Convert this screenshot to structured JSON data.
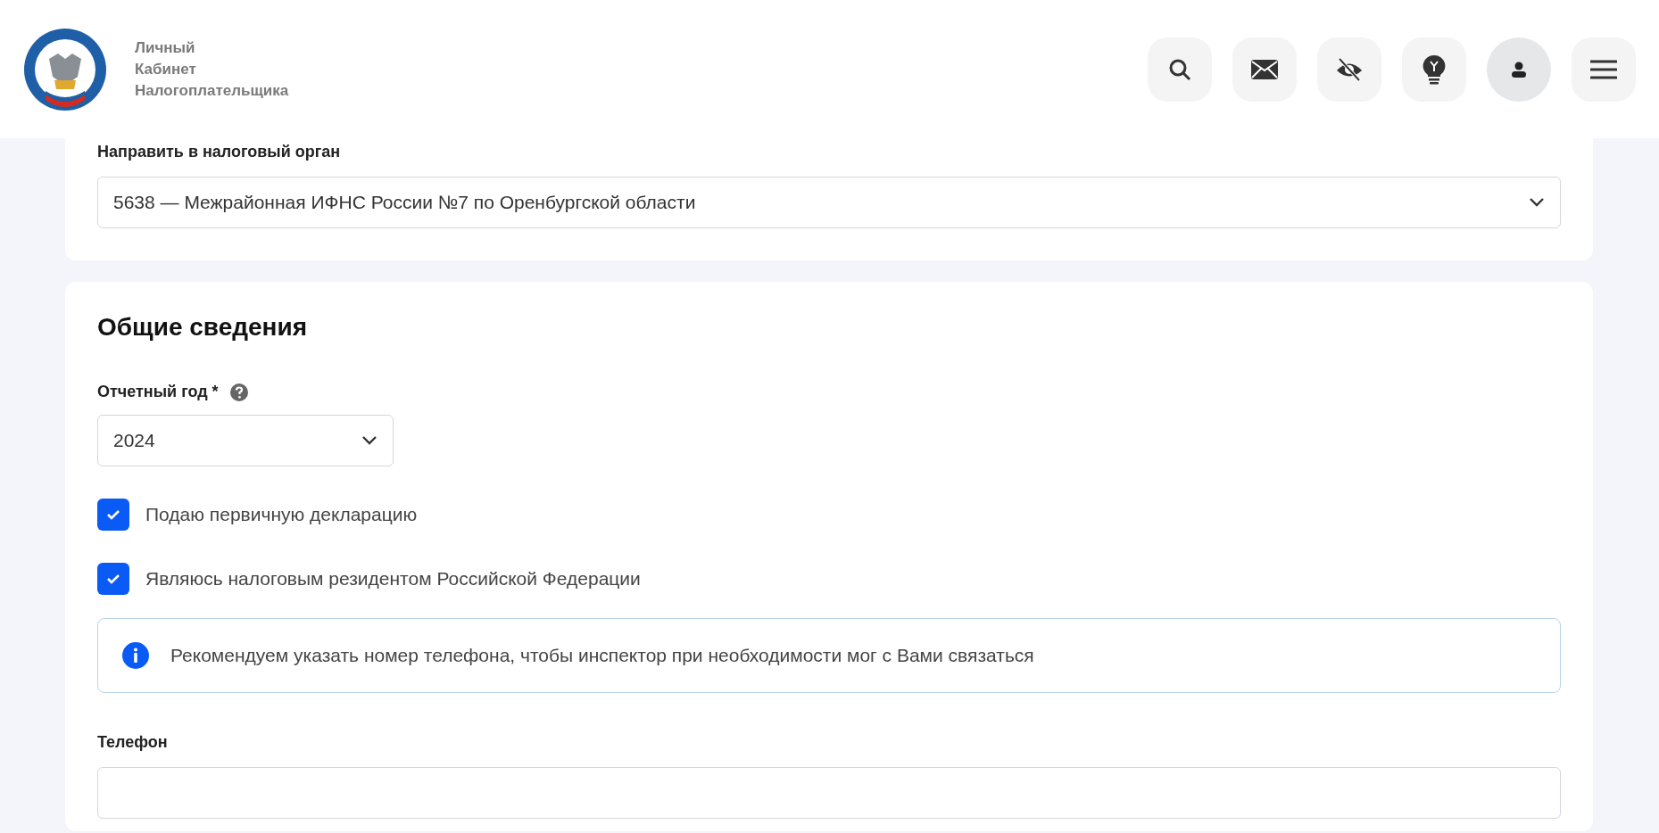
{
  "header": {
    "brand": [
      "Личный",
      "Кабинет",
      "Налогоплательщика"
    ],
    "icons": [
      {
        "kind": "search",
        "active": false
      },
      {
        "kind": "mail",
        "active": false
      },
      {
        "kind": "eye-off",
        "active": false
      },
      {
        "kind": "bulb",
        "active": false
      },
      {
        "kind": "user",
        "active": true
      },
      {
        "kind": "menu",
        "active": false
      }
    ]
  },
  "office": {
    "label": "Направить в налоговый орган",
    "value": "5638 — Межрайонная ИФНС России №7 по Оренбургской области"
  },
  "general": {
    "title": "Общие сведения",
    "year": {
      "label": "Отчетный год *",
      "value": "2024"
    },
    "checkboxes": [
      {
        "label": "Подаю первичную декларацию",
        "checked": true
      },
      {
        "label": "Являюсь налоговым резидентом Российской Федерации",
        "checked": true
      }
    ],
    "notice": "Рекомендуем указать номер телефона, чтобы инспектор при необходимости мог с Вами связаться",
    "phone": {
      "label": "Телефон"
    }
  }
}
